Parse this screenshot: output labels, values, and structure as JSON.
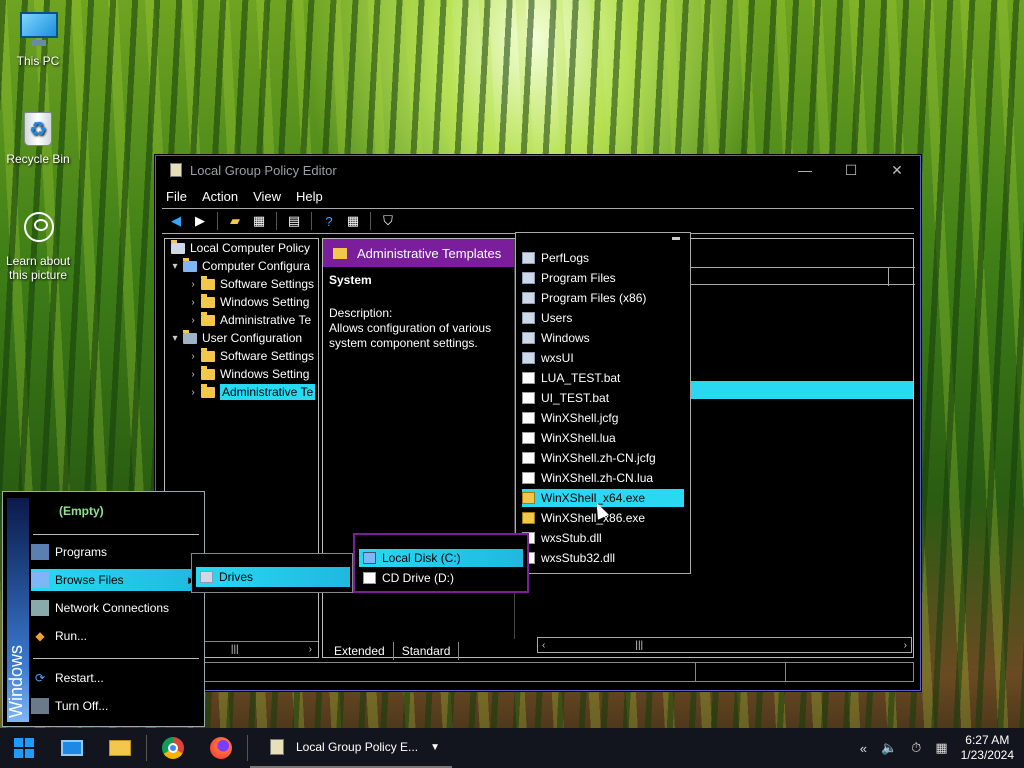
{
  "desktop": {
    "icons": [
      {
        "label": "This PC"
      },
      {
        "label": "Recycle Bin"
      },
      {
        "label": "Learn about this picture"
      }
    ]
  },
  "window": {
    "title": "Local Group Policy Editor",
    "controls": {
      "minimize": "—",
      "maximize": "☐",
      "close": "✕"
    },
    "menu": [
      "File",
      "Action",
      "View",
      "Help"
    ],
    "tree": {
      "root": "Local Computer Policy",
      "computer": "Computer Configura",
      "computer_children": [
        "Software Settings",
        "Windows Setting",
        "Administrative Te"
      ],
      "user": "User Configuration",
      "user_children": [
        "Software Settings",
        "Windows Setting",
        "Administrative Te"
      ]
    },
    "detail": {
      "header": "Administrative Templates",
      "section_title": "System",
      "description_label": "Description:",
      "description": "Allows configuration of various system component settings."
    },
    "tabs": [
      "Extended",
      "Standard"
    ]
  },
  "startmenu": {
    "side_label": "Windows",
    "empty_label": "(Empty)",
    "items": {
      "programs": "Programs",
      "browse_files": "Browse Files",
      "network": "Network Connections",
      "run": "Run...",
      "restart": "Restart...",
      "turn_off": "Turn Off..."
    }
  },
  "submenus": {
    "drives": "Drives",
    "disks": [
      "Local Disk (C:)",
      "CD Drive (D:)"
    ],
    "files": [
      {
        "name": "PerfLogs",
        "kind": "folder"
      },
      {
        "name": "Program Files",
        "kind": "folder"
      },
      {
        "name": "Program Files (x86)",
        "kind": "folder"
      },
      {
        "name": "Users",
        "kind": "folder"
      },
      {
        "name": "Windows",
        "kind": "folder"
      },
      {
        "name": "wxsUI",
        "kind": "folder"
      },
      {
        "name": "LUA_TEST.bat",
        "kind": "file"
      },
      {
        "name": "UI_TEST.bat",
        "kind": "file"
      },
      {
        "name": "WinXShell.jcfg",
        "kind": "file"
      },
      {
        "name": "WinXShell.lua",
        "kind": "file"
      },
      {
        "name": "WinXShell.zh-CN.jcfg",
        "kind": "file"
      },
      {
        "name": "WinXShell.zh-CN.lua",
        "kind": "file"
      },
      {
        "name": "WinXShell_x64.exe",
        "kind": "exe"
      },
      {
        "name": "WinXShell_x86.exe",
        "kind": "exe"
      },
      {
        "name": "wxsStub.dll",
        "kind": "file"
      },
      {
        "name": "wxsStub32.dll",
        "kind": "file"
      }
    ],
    "selected_file_index": 12
  },
  "taskbar": {
    "active_app": "Local Group Policy E...",
    "time": "6:27 AM",
    "date": "1/23/2024"
  },
  "colors": {
    "selection": "#29d9f2",
    "header": "#7a1e9c",
    "border": "#5b5bd0"
  }
}
